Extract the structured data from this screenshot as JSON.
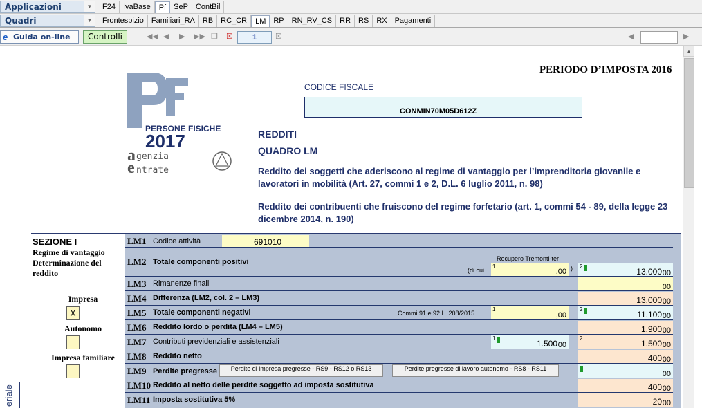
{
  "toolbar": {
    "applicazioni_label": "Applicazioni",
    "quadri_label": "Quadri",
    "top_tabs": [
      "F24",
      "IvaBase",
      "Pf",
      "SeP",
      "ContBil"
    ],
    "top_active": "Pf",
    "quadri_tabs": [
      "Frontespizio",
      "Familiari_RA",
      "RB",
      "RC_CR",
      "LM",
      "RP",
      "RN_RV_CS",
      "RR",
      "RS",
      "RX",
      "Pagamenti"
    ],
    "quadri_active": "LM",
    "guida_label": "Guida on-line",
    "controlli_label": "Controlli",
    "page_number": "1"
  },
  "header": {
    "periodo": "PERIODO D’IMPOSTA 2016",
    "codice_fiscale_label": "CODICE FISCALE",
    "codice_fiscale": "CONMIN70M05D612Z",
    "logo_line1": "PERSONE FISICHE",
    "logo_year": "2017",
    "logo_agenzia": "genzia",
    "logo_entrate": "ntrate",
    "redditi": "REDDITI",
    "quadro": "QUADRO LM",
    "desc1": "Reddito dei soggetti che aderiscono al regime di vantaggio per l’imprenditoria giovanile e lavoratori in mobilità (Art. 27, commi 1 e 2, D.L. 6 luglio 2011, n. 98)",
    "desc2": "Reddito dei contribuenti che fruiscono del regime forfetario (art. 1, commi 54 - 89, della legge 23 dicembre 2014, n. 190)"
  },
  "section": {
    "title": "SEZIONE I",
    "subtitle": "Regime di vantaggio Determinazione del reddito",
    "impresa_label": "Impresa",
    "impresa_value": "X",
    "autonomo_label": "Autonomo",
    "familiare_label": "Impresa familiare",
    "side_label": "eriale"
  },
  "rows": {
    "lm1": {
      "code": "LM1",
      "label": "Codice attività",
      "value": "691010"
    },
    "lm2": {
      "code": "LM2",
      "label": "Totale componenti positivi",
      "col1_caption": "Recupero Tremonti-ter",
      "dicui": "(di cui",
      "col1_value": ",00",
      "close": ")",
      "col2_value": "13.000",
      "dec": "00"
    },
    "lm3": {
      "code": "LM3",
      "label": "Rimanenze finali",
      "value": "",
      "dec": "00"
    },
    "lm4": {
      "code": "LM4",
      "label": "Differenza (LM2, col. 2 – LM3)",
      "value": "13.000",
      "dec": "00"
    },
    "lm5": {
      "code": "LM5",
      "label": "Totale componenti negativi",
      "col1_caption": "Commi 91 e 92 L. 208/2015",
      "col1_value": ",00",
      "col2_value": "11.100",
      "dec": "00"
    },
    "lm6": {
      "code": "LM6",
      "label": "Reddito lordo o perdita (LM4 – LM5)",
      "value": "1.900",
      "dec": "00"
    },
    "lm7": {
      "code": "LM7",
      "label": "Contributi previdenziali e assistenziali",
      "col1_value": "1.500",
      "col2_value": "1.500",
      "dec": "00"
    },
    "lm8": {
      "code": "LM8",
      "label": "Reddito netto",
      "value": "400",
      "dec": "00"
    },
    "lm9": {
      "code": "LM9",
      "label": "Perdite pregresse",
      "btn1": "Perdite di impresa pregresse - RS9 - RS12 o RS13",
      "btn2": "Perdite pregresse di lavoro autonomo - RS8 - RS11",
      "value": "",
      "dec": "00"
    },
    "lm10": {
      "code": "LM10",
      "label": "Reddito al netto delle perdite soggetto ad imposta sostitutiva",
      "value": "400",
      "dec": "00"
    },
    "lm11": {
      "code": "LM11",
      "label": "Imposta sostitutiva 5%",
      "value": "20",
      "dec": "00"
    }
  }
}
